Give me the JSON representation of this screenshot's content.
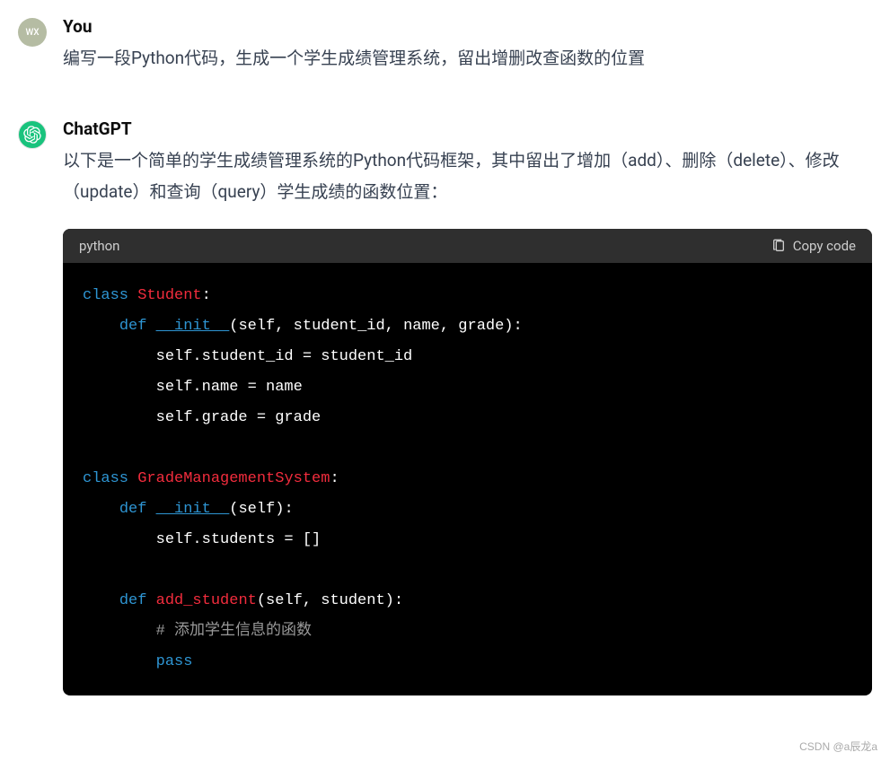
{
  "user": {
    "avatar_text": "WX",
    "author": "You",
    "message": "编写一段Python代码，生成一个学生成绩管理系统，留出增删改查函数的位置"
  },
  "assistant": {
    "author": "ChatGPT",
    "message": "以下是一个简单的学生成绩管理系统的Python代码框架，其中留出了增加（add）、删除（delete）、修改（update）和查询（query）学生成绩的函数位置："
  },
  "code_block": {
    "language": "python",
    "copy_label": "Copy code",
    "tokens": {
      "class_kw": "class",
      "student_cls": "Student",
      "gms_cls": "GradeManagementSystem",
      "def_kw": "def",
      "init_fn": "__init__",
      "add_fn": "add_student",
      "init_params1": "(self, student_id, name, grade):",
      "init_params2": "(self):",
      "add_params": "(self, student):",
      "body1": "        self.student_id = student_id",
      "body2": "        self.name = name",
      "body3": "        self.grade = grade",
      "body4": "        self.students = []",
      "comment1": "# 添加学生信息的函数",
      "pass_kw": "pass"
    }
  },
  "watermark": "CSDN @a辰龙a"
}
